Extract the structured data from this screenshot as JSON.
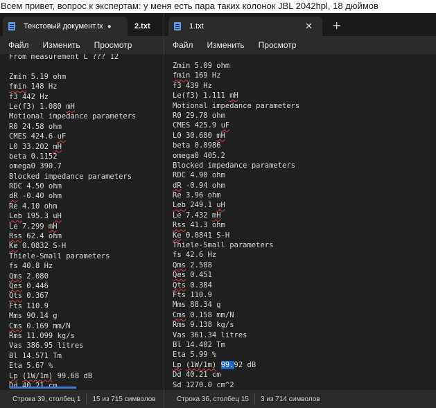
{
  "caption": "Всем привет, вопрос к экспертам: у меня есть пара таких колонок JBL 2042hpl, 18 дюймов",
  "menu": {
    "file": "Файл",
    "edit": "Изменить",
    "view": "Просмотр"
  },
  "left": {
    "tab1": "Текстовый документ.tx",
    "tab1_modified": "●",
    "tab2": "2.txt",
    "status_pos": "Строка 39, столбец 1",
    "status_count": "15 из 715 символов",
    "lines": [
      "From measurement L ??? 12",
      "",
      "Zmin 5.19 ohm",
      "fmin 148 Hz",
      "f3 442 Hz",
      "Le(f3) 1.080 mH",
      "Motional impedance parameters",
      "R0 24.58 ohm",
      "CMES 424.6 uF",
      "L0 33.202 mH",
      "beta 0.1152",
      "omega0 390.7",
      "Blocked impedance parameters",
      "RDC 4.50 ohm",
      "dR -0.40 ohm",
      "Re 4.10 ohm",
      "Leb 195.3 uH",
      "Le 7.299 mH",
      "Rss 62.4 ohm",
      "Ke 0.0832 S-H",
      "Thiele-Small parameters",
      "fs 40.8 Hz",
      "Qms 2.080",
      "Qes 0.446",
      "Qts 0.367",
      "Fts 110.9",
      "Mms 90.14 g",
      "Cms 0.169 mm/N",
      "Rms 11.099 kg/s",
      "Vas 386.95 litres",
      "Bl 14.571 Tm",
      "Eta 5.67 %",
      "Lp (1W/1m) 99.68 dB",
      "Dd 40.21 cm"
    ]
  },
  "right": {
    "tab": "1.txt",
    "close_icon": "✕",
    "new_tab": "+",
    "status_pos": "Строка 36, столбец 15",
    "status_count": "3 из 714 символов",
    "lines": [
      "Zmin 5.09 ohm",
      "fmin 169 Hz",
      "f3 439 Hz",
      "Le(f3) 1.111 mH",
      "Motional impedance parameters",
      "R0 29.78 ohm",
      "CMES 425.9 uF",
      "L0 30.680 mH",
      "beta 0.0986",
      "omega0 405.2",
      "Blocked impedance parameters",
      "RDC 4.90 ohm",
      "dR -0.94 ohm",
      "Re 3.96 ohm",
      "Leb 249.1 uH",
      "Le 7.432 mH",
      "Rss 41.3 ohm",
      "Ke 0.0841 S-H",
      "Thiele-Small parameters",
      "fs 42.6 Hz",
      "Qms 2.588",
      "Qes 0.451",
      "Qts 0.384",
      "Fts 110.9",
      "Mms 88.34 g",
      "Cms 0.158 mm/N",
      "Rms 9.138 kg/s",
      "Vas 361.34 litres",
      "Bl 14.402 Tm",
      "Eta 5.99 %",
      "Lp (1W/1m) 99.92 dB",
      "Dd 40.21 cm",
      "Sd 1270.0 cm^2"
    ]
  },
  "colors": {
    "editor_bg": "#1f1f1f",
    "chrome_bg": "#2b2b2b",
    "selection": "#1e63c5",
    "spellcheck": "#e0404a",
    "accent": "#5b9be6"
  }
}
